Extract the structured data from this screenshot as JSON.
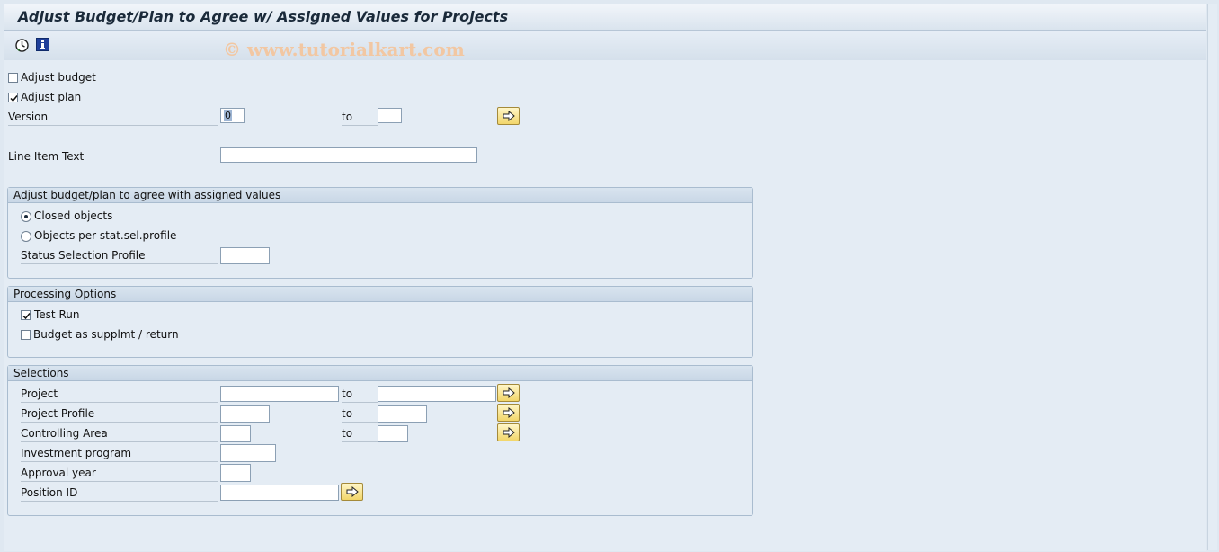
{
  "window": {
    "title": "Adjust Budget/Plan to Agree w/ Assigned Values for Projects"
  },
  "toolbar": {
    "items": [
      {
        "icon": "execute-clock-icon"
      },
      {
        "icon": "info-icon"
      }
    ],
    "watermark": "© www.tutorialkart.com"
  },
  "top": {
    "adjust_budget": {
      "label": "Adjust budget",
      "checked": false
    },
    "adjust_plan": {
      "label": "Adjust plan",
      "checked": true
    },
    "version": {
      "label": "Version",
      "value": "0",
      "to_label": "to",
      "to_value": ""
    },
    "line_item_text": {
      "label": "Line Item Text",
      "value": ""
    }
  },
  "adjust_group": {
    "title": "Adjust budget/plan to agree with assigned values",
    "closed_objects": {
      "label": "Closed objects",
      "selected": true
    },
    "objects_per_profile": {
      "label": "Objects per stat.sel.profile",
      "selected": false
    },
    "status_selection_profile": {
      "label": "Status Selection Profile",
      "value": ""
    }
  },
  "processing_group": {
    "title": "Processing Options",
    "test_run": {
      "label": "Test Run",
      "checked": true
    },
    "budget_supplmt": {
      "label": "Budget as supplmt / return",
      "checked": false
    }
  },
  "selections_group": {
    "title": "Selections",
    "project": {
      "label": "Project",
      "to_label": "to"
    },
    "project_profile": {
      "label": "Project Profile",
      "to_label": "to"
    },
    "controlling_area": {
      "label": "Controlling Area",
      "to_label": "to"
    },
    "investment_program": {
      "label": "Investment program"
    },
    "approval_year": {
      "label": "Approval year"
    },
    "position_id": {
      "label": "Position ID"
    }
  },
  "colors": {
    "background": "#dfe8f1",
    "button_yellow": "#f2d66a",
    "watermark": "#f2c7a2"
  }
}
